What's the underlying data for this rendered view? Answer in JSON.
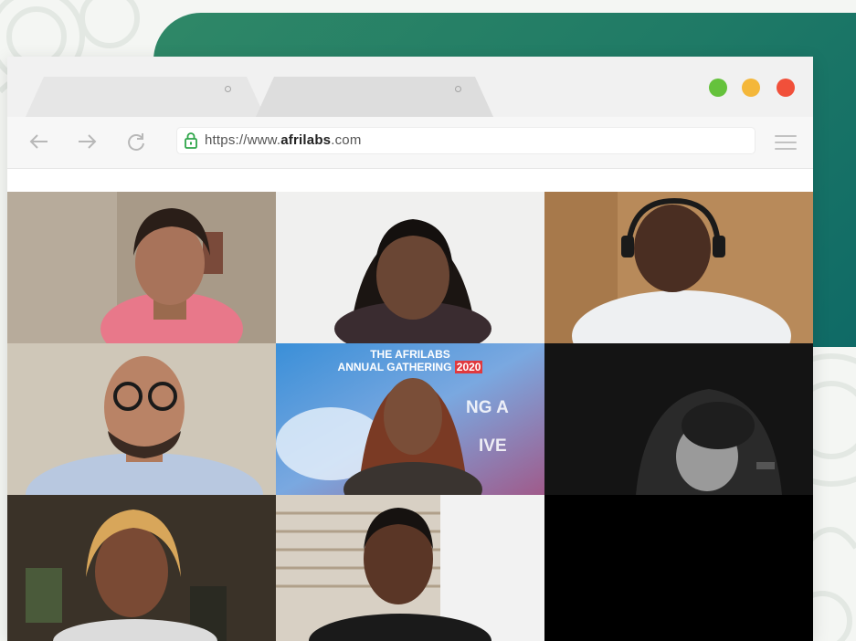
{
  "browser": {
    "url_prefix": "https://www.",
    "url_domain": "afrilabs",
    "url_suffix": ".com",
    "window_buttons": [
      {
        "name": "minimize",
        "color": "#65c23c"
      },
      {
        "name": "maximize",
        "color": "#f4b73a"
      },
      {
        "name": "close",
        "color": "#f1503a"
      }
    ]
  },
  "call": {
    "banner_line1": "THE AFRILABS",
    "banner_line2": "ANNUAL GATHERING",
    "banner_year": "2020",
    "bg_text_1": "NG A",
    "bg_text_2": "IVE"
  },
  "colors": {
    "brand_green": "#2f8867",
    "brand_teal": "#0f6a66",
    "banner_red": "#e0393e"
  }
}
